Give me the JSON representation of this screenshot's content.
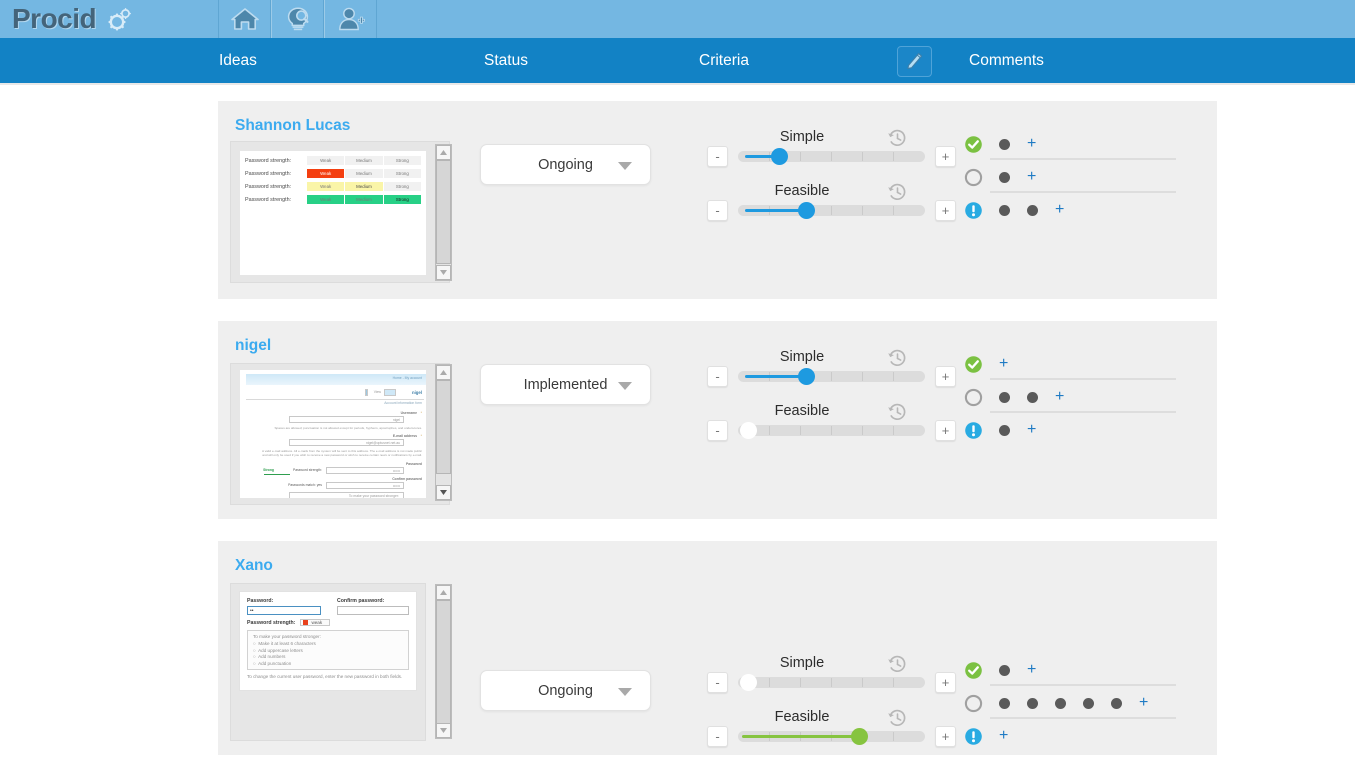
{
  "brand": {
    "name": "Procid",
    "gear_icon": "gears-icon"
  },
  "header": {
    "icons": [
      {
        "name": "home-icon",
        "label": "Home"
      },
      {
        "name": "idea-bulb-icon",
        "label": "Ideas"
      },
      {
        "name": "add-user-icon",
        "label": "Add user"
      }
    ]
  },
  "tabs": [
    {
      "label": "Ideas",
      "name": "tab-ideas"
    },
    {
      "label": "Status",
      "name": "tab-status"
    },
    {
      "label": "Criteria",
      "name": "tab-criteria"
    },
    {
      "label": "Comments",
      "name": "tab-comments"
    }
  ],
  "edit_button": {
    "icon": "pencil-icon",
    "label": "Edit"
  },
  "colors": {
    "brand_bar": "#74b7e2",
    "tab_bar": "#1282c5",
    "card_bg": "#efefef",
    "title": "#3cabef",
    "slider_blue": "#1e9ae0",
    "slider_green": "#86c440",
    "accept_green": "#7bc142",
    "alert_blue": "#29abe2",
    "plus_blue": "#1f7bc4"
  },
  "rows": [
    {
      "title": "Shannon Lucas",
      "status": "Ongoing",
      "thumbnail": {
        "type": "password-strength-table",
        "rows": [
          {
            "label": "Password strength:",
            "level": "",
            "fill": 0,
            "color": "#f1f1f1",
            "words": [
              "Weak",
              "Medium",
              "Strong"
            ]
          },
          {
            "label": "Password strength:",
            "level": "Weak",
            "fill": 1,
            "color": "#f43f10",
            "words": [
              "Weak",
              "Medium",
              "Strong"
            ]
          },
          {
            "label": "Password strength:",
            "level": "Medium",
            "fill": 2,
            "color": "#faf5a8",
            "words": [
              "Weak",
              "Medium",
              "Strong"
            ]
          },
          {
            "label": "Password strength:",
            "level": "Strong",
            "fill": 3,
            "color": "#27d086",
            "words": [
              "Weak",
              "Medium",
              "Strong"
            ]
          }
        ]
      },
      "criteria": [
        {
          "label": "Simple",
          "value": 22,
          "color": "#1e9ae0",
          "history_icon": "history-clock-icon"
        },
        {
          "label": "Feasible",
          "value": 36,
          "color": "#1e9ae0",
          "history_icon": "history-clock-icon"
        }
      ],
      "comments": [
        {
          "icon": "check-circle-icon",
          "dots": 1
        },
        {
          "icon": "empty-circle-icon",
          "dots": 1
        },
        {
          "icon": "alert-circle-icon",
          "dots": 2
        }
      ]
    },
    {
      "title": "nigel",
      "status": "Implemented",
      "thumbnail": {
        "type": "account-form-screenshot",
        "caption": "Account information form",
        "fields": [
          "Username",
          "E-mail address",
          "Password",
          "Confirm password"
        ],
        "username_value": "nigel",
        "strength": "Strong",
        "match": "Passwords match: yes"
      },
      "criteria": [
        {
          "label": "Simple",
          "value": 36,
          "color": "#1e9ae0",
          "history_icon": "history-clock-icon"
        },
        {
          "label": "Feasible",
          "value": 0,
          "color": "#1e9ae0",
          "history_icon": "history-clock-icon"
        }
      ],
      "comments": [
        {
          "icon": "check-circle-icon",
          "dots": 0
        },
        {
          "icon": "empty-circle-icon",
          "dots": 2
        },
        {
          "icon": "alert-circle-icon",
          "dots": 1
        }
      ]
    },
    {
      "title": "Xano",
      "status": "Ongoing",
      "thumbnail": {
        "type": "password-form-screenshot",
        "password_label": "Password:",
        "password_value": "••",
        "confirm_label": "Confirm password:",
        "confirm_value": "",
        "strength_label": "Password strength:",
        "strength_value": "weak",
        "tips_title": "To make your password stronger:",
        "tips": [
          "Make it at least 6 characters",
          "Add uppercase letters",
          "Add numbers",
          "Add punctuation"
        ],
        "footer": "To change the current user password, enter the new password in both fields."
      },
      "criteria": [
        {
          "label": "Simple",
          "value": 0,
          "color": "#1e9ae0",
          "history_icon": "history-clock-icon"
        },
        {
          "label": "Feasible",
          "value": 65,
          "color": "#86c440",
          "history_icon": "history-clock-icon"
        }
      ],
      "comments": [
        {
          "icon": "check-circle-icon",
          "dots": 1
        },
        {
          "icon": "empty-circle-icon",
          "dots": 5
        },
        {
          "icon": "alert-circle-icon",
          "dots": 0
        }
      ]
    }
  ],
  "controls": {
    "minus": "-",
    "plus": "+",
    "add": "+"
  }
}
